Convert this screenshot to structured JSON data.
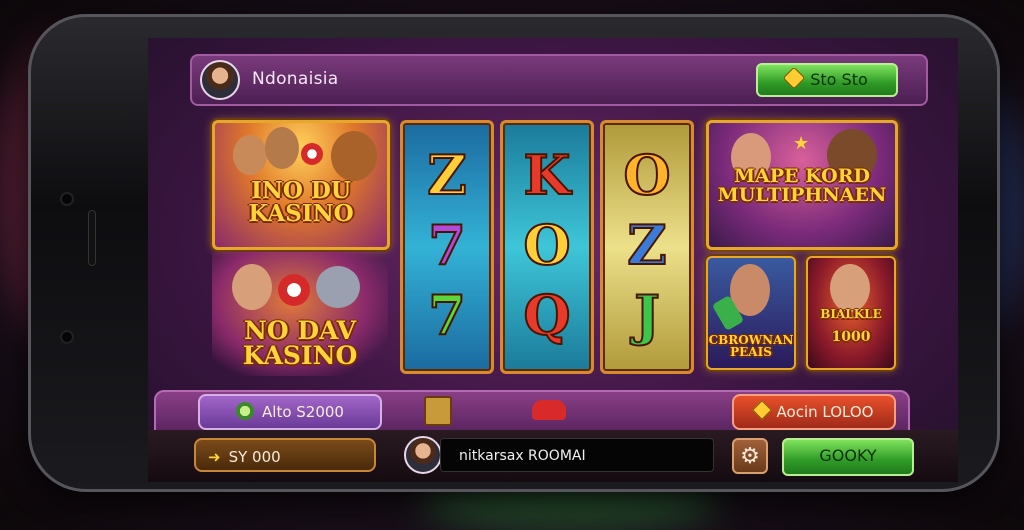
{
  "header": {
    "title": "Ndonaisia",
    "top_button": "Sto Sto",
    "top_button_icon": "tag-icon"
  },
  "tiles": {
    "top_left": "INO DU KASINO",
    "bottom_left": "NO DAV KASINO",
    "top_right": "MAPE KORD MULTIPHNAEN",
    "bottom_right_a": "CBROWNAN PEAIS",
    "bottom_right_b_label": "BIALKLE",
    "bottom_right_b_value": "1000"
  },
  "reels": [
    [
      "Z",
      "7",
      "7"
    ],
    [
      "K",
      "O",
      "Q"
    ],
    [
      "O",
      "Z",
      "J"
    ]
  ],
  "panel": {
    "left_label": "Alto S2000",
    "right_label": "Aocin LOLOO"
  },
  "footer": {
    "balance": "SY 000",
    "player_text": "nitkarsax ROOMAI",
    "ok_button": "GOOKY"
  },
  "colors": {
    "accent_purple": "#6c2a6a",
    "gold": "#e7a72a",
    "green_button": "#2f9b26"
  }
}
